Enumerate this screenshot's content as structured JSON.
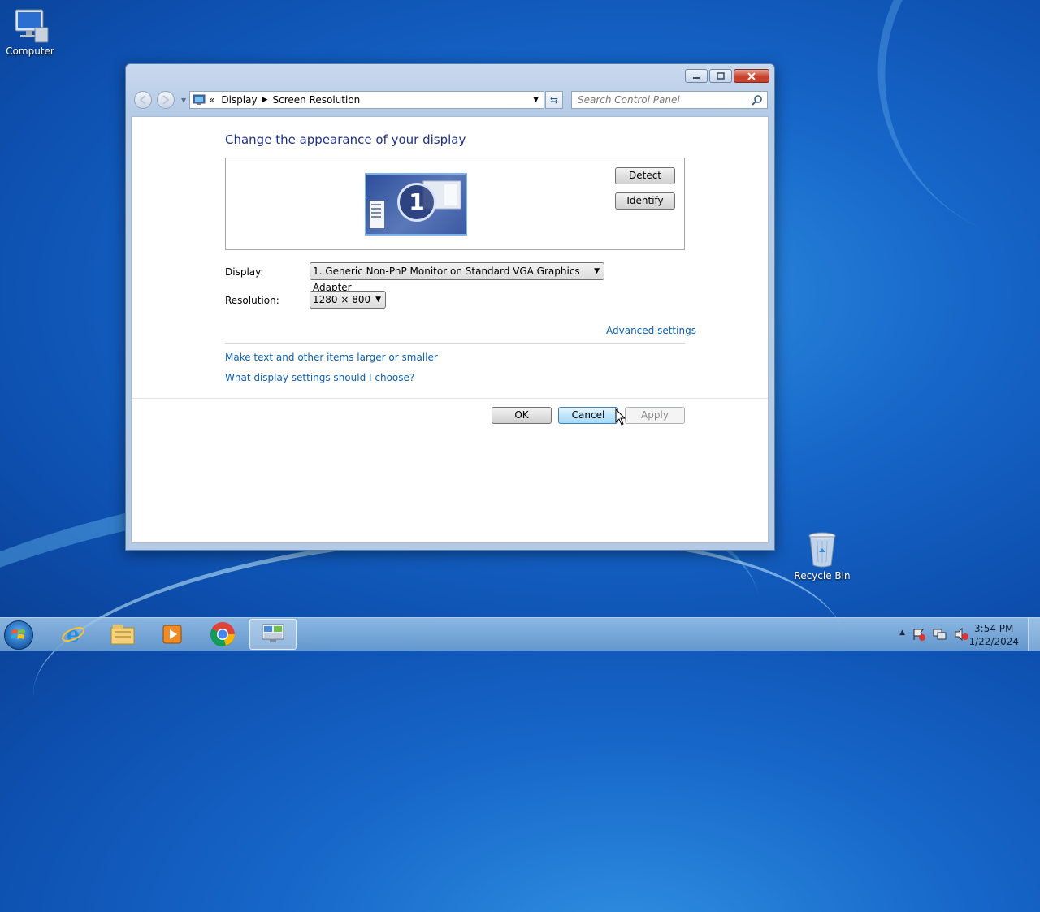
{
  "desktop": {
    "icons": [
      {
        "label": "Computer"
      },
      {
        "label": "Recycle Bin"
      }
    ]
  },
  "window": {
    "address": {
      "root_chevron": "«",
      "crumbs": [
        "Display",
        "Screen Resolution"
      ]
    },
    "search": {
      "placeholder": "Search Control Panel"
    },
    "heading": "Change the appearance of your display",
    "monitor_number": "1",
    "detect_label": "Detect",
    "identify_label": "Identify",
    "display_label": "Display:",
    "display_value": "1. Generic Non-PnP Monitor on Standard VGA Graphics Adapter",
    "resolution_label": "Resolution:",
    "resolution_value": "1280 × 800",
    "advanced_link": "Advanced settings",
    "link_text_size": "Make text and other items larger or smaller",
    "link_help": "What display settings should I choose?",
    "ok_label": "OK",
    "cancel_label": "Cancel",
    "apply_label": "Apply"
  },
  "taskbar": {
    "apps": [
      "start-orb",
      "internet-explorer-icon",
      "file-explorer-icon",
      "media-player-icon",
      "chrome-icon",
      "control-panel-icon"
    ],
    "clock": {
      "time": "3:54 PM",
      "date": "1/22/2024"
    }
  },
  "colors": {
    "accent_link": "#0b5fb4",
    "heading": "#1e3287"
  }
}
